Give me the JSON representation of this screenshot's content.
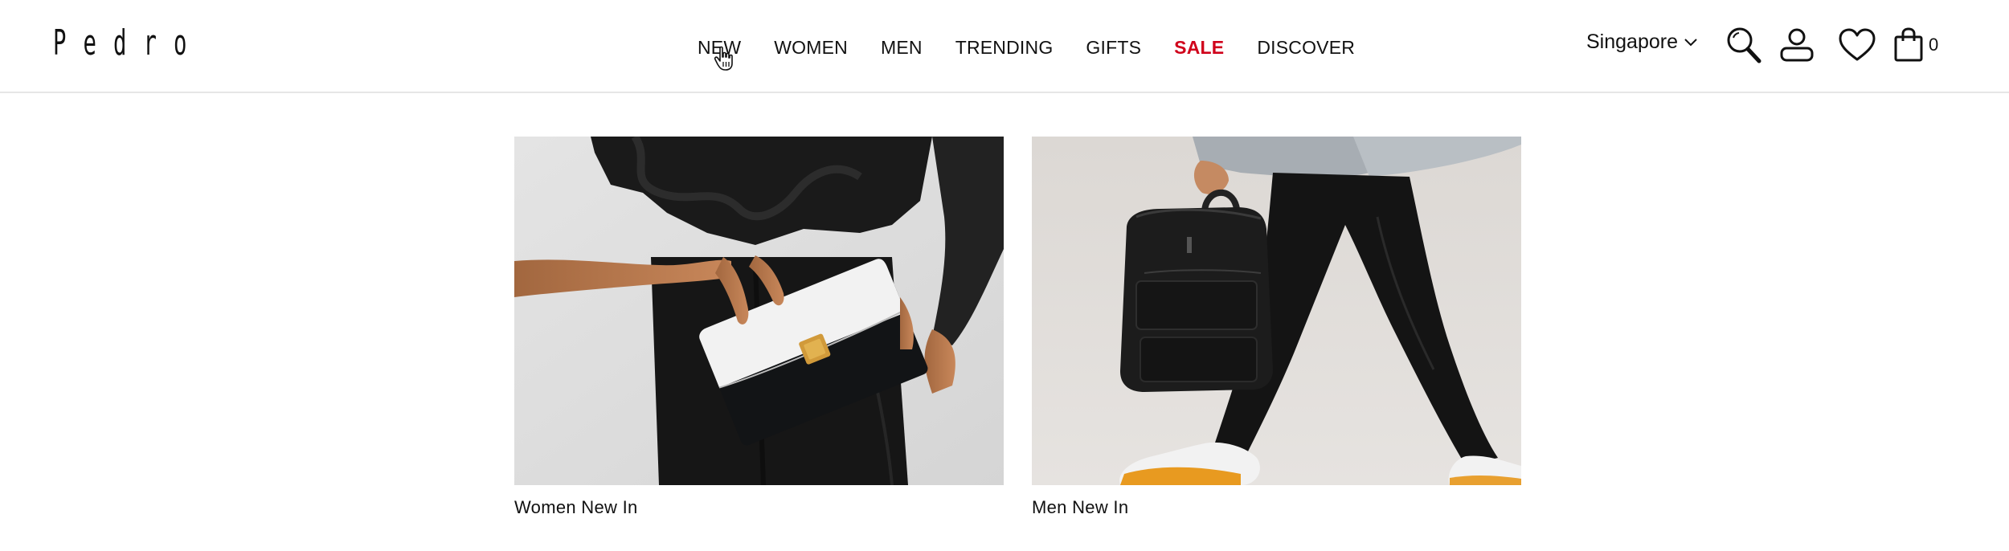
{
  "brand": {
    "logo_text": "Pedro"
  },
  "nav": {
    "items": [
      {
        "label": "NEW",
        "highlight": false
      },
      {
        "label": "WOMEN",
        "highlight": false
      },
      {
        "label": "MEN",
        "highlight": false
      },
      {
        "label": "TRENDING",
        "highlight": false
      },
      {
        "label": "GIFTS",
        "highlight": false
      },
      {
        "label": "SALE",
        "highlight": true
      },
      {
        "label": "DISCOVER",
        "highlight": false
      }
    ]
  },
  "region": {
    "label": "Singapore",
    "icon": "chevron-down-icon"
  },
  "header_icons": {
    "search": "search-icon",
    "account": "user-icon",
    "wishlist": "heart-icon",
    "cart": "shopping-bag-icon",
    "cart_count": "0"
  },
  "tiles": [
    {
      "caption": "Women New In",
      "image": "woman holding black and white handbag with gold clasp"
    },
    {
      "caption": "Men New In",
      "image": "man walking carrying black backpack"
    }
  ],
  "colors": {
    "sale": "#d0021b",
    "text": "#111111",
    "divider": "#e6e6e6"
  }
}
